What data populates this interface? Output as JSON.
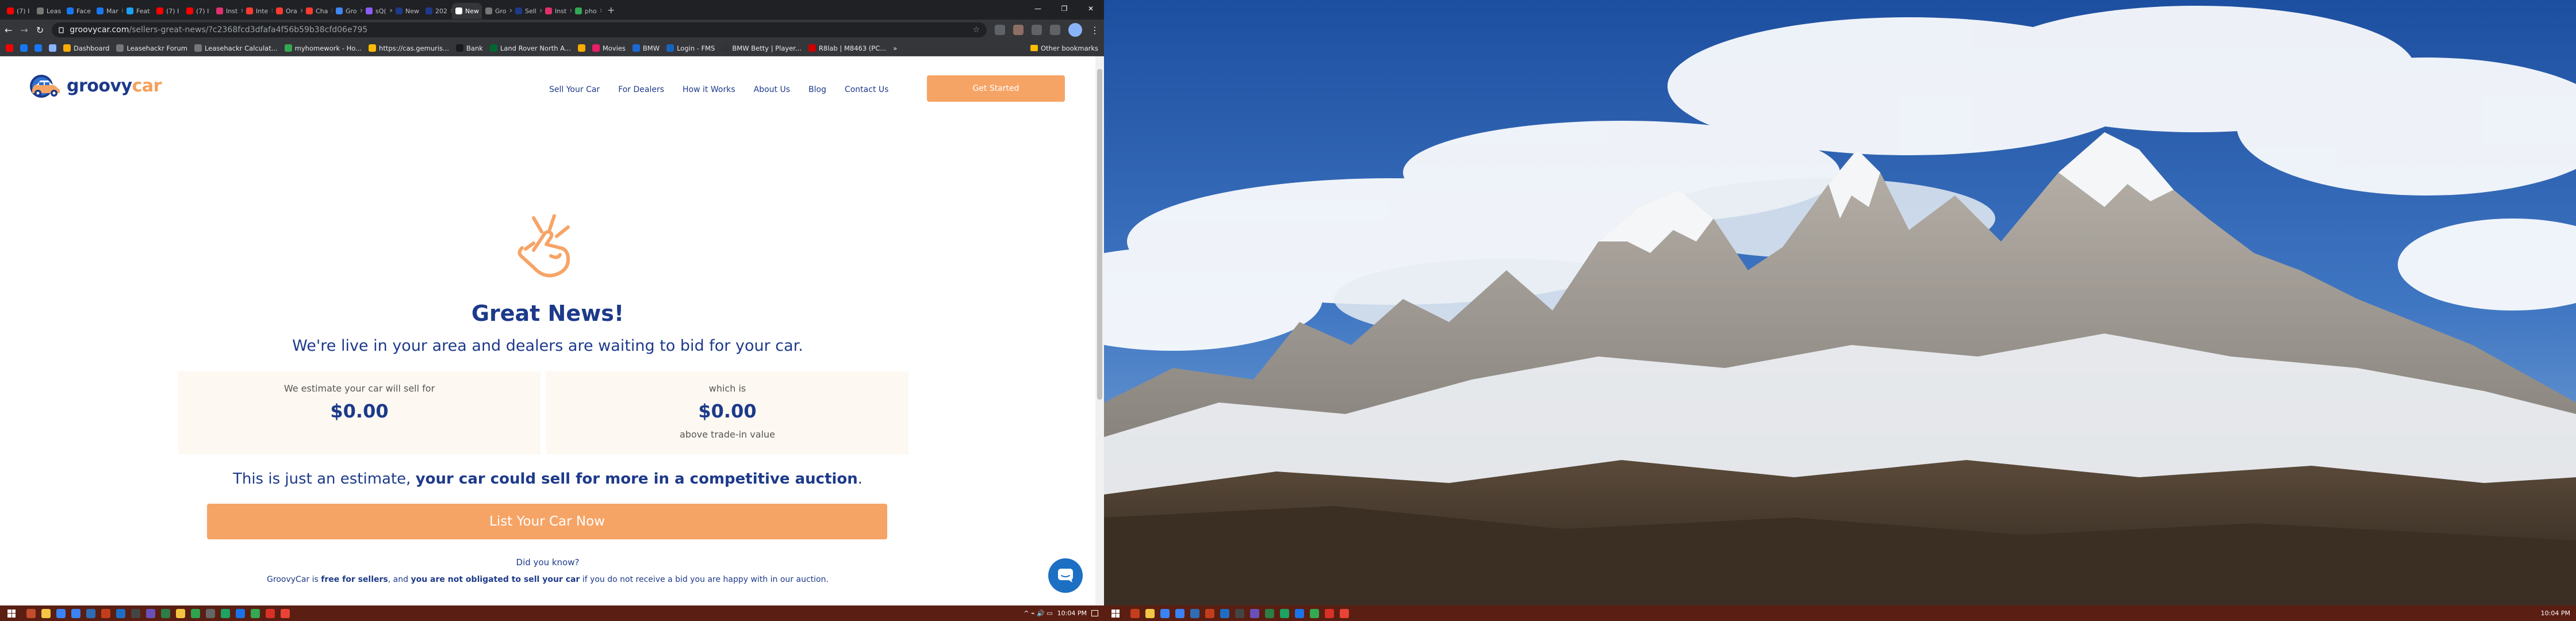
{
  "browser": {
    "tabs": [
      {
        "label": "(7) I",
        "color": "#ff0000"
      },
      {
        "label": "Leas",
        "color": "#777777"
      },
      {
        "label": "Face",
        "color": "#1877f2"
      },
      {
        "label": "Mar",
        "color": "#1877f2"
      },
      {
        "label": "Feat",
        "color": "#1da1f2"
      },
      {
        "label": "(7) I",
        "color": "#ff0000"
      },
      {
        "label": "(7) I",
        "color": "#ff0000"
      },
      {
        "label": "Inst",
        "color": "#e1306c"
      },
      {
        "label": "Inte",
        "color": "#ff3b30"
      },
      {
        "label": "Ora",
        "color": "#ff3b30"
      },
      {
        "label": "Cha",
        "color": "#ff3b30"
      },
      {
        "label": "Gro",
        "color": "#4285f4"
      },
      {
        "label": "sQ(",
        "color": "#8b5cf6"
      },
      {
        "label": "New",
        "color": "#1d3a8a"
      },
      {
        "label": "202",
        "color": "#1d3a8a"
      },
      {
        "label": "New",
        "color": "#ffffff"
      },
      {
        "label": "Gro",
        "color": "#777777"
      },
      {
        "label": "Sell",
        "color": "#1d3a8a"
      },
      {
        "label": "Inst",
        "color": "#e1306c"
      },
      {
        "label": "pho",
        "color": "#34a853"
      }
    ],
    "active_tab_index": 15,
    "close_glyph": "✕",
    "new_tab_glyph": "+",
    "window_controls": [
      "—",
      "❐",
      "✕"
    ],
    "url_host": "groovycar.com",
    "url_path": "/sellers-great-news/?c2368fcd3dfafa4f56b59b38cfd06e795",
    "nav_glyphs": {
      "back": "←",
      "forward": "→",
      "reload": "↻",
      "star": "☆"
    },
    "bookmarks": [
      {
        "label": "",
        "color": "#ff0000"
      },
      {
        "label": "",
        "color": "#1877f2"
      },
      {
        "label": "",
        "color": "#1877f2"
      },
      {
        "label": "",
        "color": "#8ab4f8"
      },
      {
        "label": "Dashboard",
        "color": "#f9ab00"
      },
      {
        "label": "Leasehackr Forum",
        "color": "#777777"
      },
      {
        "label": "Leasehackr Calculat...",
        "color": "#777777"
      },
      {
        "label": "myhomework - Ho...",
        "color": "#34a853"
      },
      {
        "label": "https://cas.gemuris...",
        "color": "#fbbc04"
      },
      {
        "label": "Bank",
        "color": "#1a1a1a"
      },
      {
        "label": "Land Rover North A...",
        "color": "#006633"
      },
      {
        "label": "",
        "color": "#f9ab00"
      },
      {
        "label": "Movies",
        "color": "#e91e63"
      },
      {
        "label": "BMW",
        "color": "#1c69d4"
      },
      {
        "label": "Login - FMS",
        "color": "#1565c0"
      },
      {
        "label": "BMW Betty | Player...",
        "color": "#333333"
      },
      {
        "label": "R8lab | M8463 (PC...",
        "color": "#cc0000"
      }
    ],
    "bookmarks_overflow": "»",
    "other_bookmarks": "Other bookmarks"
  },
  "site": {
    "logo_part1": "groovy",
    "logo_part2": "car",
    "nav": [
      "Sell Your Car",
      "For Dealers",
      "How it Works",
      "About Us",
      "Blog",
      "Contact Us"
    ],
    "cta_header": "Get Started",
    "headline": "Great News!",
    "subheadline": "We're live in your area and dealers are waiting to bid for your car.",
    "card_left": {
      "label": "We estimate your car will sell for",
      "value": "$0.00"
    },
    "card_right": {
      "label": "which is",
      "value": "$0.00",
      "sub": "above trade-in value"
    },
    "estimate_plain": "This is just an estimate,",
    "estimate_bold": "your car could sell for more in a competitive auction",
    "estimate_end": ".",
    "cta_main": "List Your Car Now",
    "did_you_know": "Did you know?",
    "note_1": "GroovyCar is",
    "note_2": "free for sellers",
    "note_3": ", and",
    "note_4": "you are not obligated to sell your car",
    "note_5": "if you do not receive a bid you are happy with in our auction."
  },
  "colors": {
    "brand_navy": "#1d3a8a",
    "brand_orange": "#f6a466",
    "card_bg": "#fdf8f1",
    "taskbar": "#5a1e12"
  },
  "taskbar": {
    "left_time": "10:04 PM",
    "right_time": "10:04 PM",
    "tray_glyphs": "^ ⌁ 🔊 ▭",
    "left_apps": [
      "#c24c2c",
      "#f3c745",
      "#3b82f6",
      "#3b82f6",
      "#2f6db5",
      "#c43e1c",
      "#1d6fc4",
      "#444",
      "#6b4fbb",
      "#2d7d46",
      "#f5c542",
      "#2ea44f",
      "#666",
      "#1ea362",
      "#1a73e8",
      "#34a853",
      "#d93025",
      "#ea4335"
    ],
    "right_apps": [
      "#c43e1c",
      "#f3c745",
      "#3b82f6",
      "#3b82f6",
      "#2f6db5",
      "#c43e1c",
      "#1d6fc4",
      "#444",
      "#6b4fbb",
      "#2d7d46",
      "#1ea362",
      "#1a73e8",
      "#34a853",
      "#d93025",
      "#ea4335"
    ]
  }
}
